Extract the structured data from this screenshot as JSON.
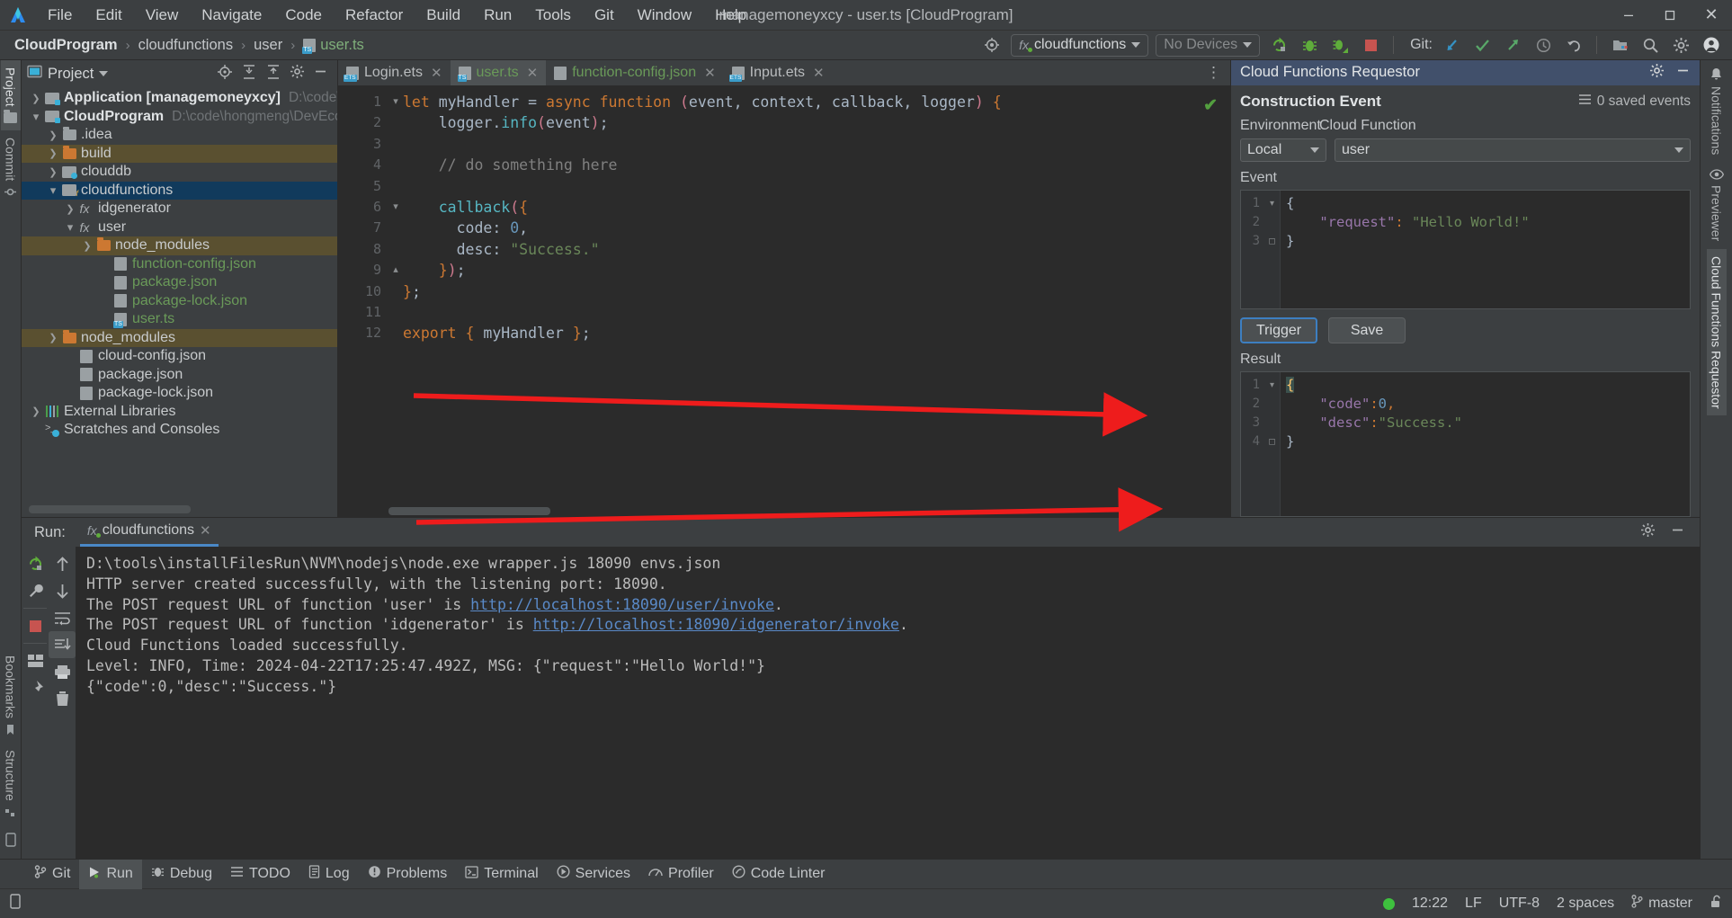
{
  "window": {
    "title": "managemoneyxcy - user.ts [CloudProgram]",
    "minimize": "–",
    "maximize": "❐",
    "close": "✕"
  },
  "menu": {
    "items": [
      "File",
      "Edit",
      "View",
      "Navigate",
      "Code",
      "Refactor",
      "Build",
      "Run",
      "Tools",
      "Git",
      "Window",
      "Help"
    ]
  },
  "breadcrumb": {
    "project": "CloudProgram",
    "folder": "cloudfunctions",
    "module": "user",
    "file": "user.ts",
    "separator": "›"
  },
  "toolbar": {
    "run_config": "cloudfunctions",
    "run_config_prefix": "fx",
    "device": "No Devices",
    "git_label": "Git:",
    "icons": [
      "target-icon",
      "run-icon",
      "debug-icon",
      "profile-debug-icon",
      "stop-icon",
      "git-update-icon",
      "git-commit-icon",
      "git-push-icon",
      "git-history-icon",
      "git-rollback-icon",
      "project-structure-icon",
      "search-icon",
      "settings-icon",
      "account-icon"
    ]
  },
  "left_rail": {
    "items": [
      {
        "label": "Project",
        "icon": "folder-icon",
        "active": true
      },
      {
        "label": "Commit",
        "icon": "commit-icon",
        "active": false
      }
    ],
    "bottom_items": [
      {
        "label": "Bookmarks",
        "icon": "bookmark-icon"
      },
      {
        "label": "Structure",
        "icon": "structure-icon"
      }
    ]
  },
  "right_rail": {
    "items": [
      {
        "label": "Notifications",
        "icon": "bell-icon",
        "active": false
      },
      {
        "label": "Previewer",
        "icon": "eye-icon",
        "active": false
      },
      {
        "label": "Cloud Functions Requestor",
        "icon": "",
        "active": true
      }
    ]
  },
  "project_panel": {
    "title": "Project",
    "header_icons": [
      "locate-icon",
      "expand-all-icon",
      "collapse-all-icon",
      "settings-icon",
      "hide-icon"
    ],
    "tree": [
      {
        "indent": 0,
        "arrow": "›",
        "icon": "module-icon",
        "label": "Application [managemoneyxcy]",
        "bold": true,
        "path": "D:\\code\\hongmen",
        "sel": ""
      },
      {
        "indent": 0,
        "arrow": "⌄",
        "icon": "module-icon",
        "label": "CloudProgram",
        "bold": true,
        "path": "D:\\code\\hongmeng\\DevEcoStudioP",
        "sel": ""
      },
      {
        "indent": 1,
        "arrow": "›",
        "icon": "folder-icon",
        "label": ".idea",
        "bold": false,
        "path": "",
        "sel": ""
      },
      {
        "indent": 1,
        "arrow": "›",
        "icon": "folder-orange-icon",
        "label": "build",
        "bold": false,
        "path": "",
        "sel": "sel-olive"
      },
      {
        "indent": 1,
        "arrow": "›",
        "icon": "db-folder-icon",
        "label": "clouddb",
        "bold": false,
        "path": "",
        "sel": ""
      },
      {
        "indent": 1,
        "arrow": "⌄",
        "icon": "fx-folder-icon",
        "label": "cloudfunctions",
        "bold": false,
        "path": "",
        "sel": "sel-blue"
      },
      {
        "indent": 2,
        "arrow": "›",
        "icon": "fx-icon",
        "label": "idgenerator",
        "bold": false,
        "path": "",
        "sel": ""
      },
      {
        "indent": 2,
        "arrow": "⌄",
        "icon": "fx-icon",
        "label": "user",
        "bold": false,
        "path": "",
        "sel": ""
      },
      {
        "indent": 3,
        "arrow": "›",
        "icon": "folder-orange-icon",
        "label": "node_modules",
        "bold": false,
        "path": "",
        "sel": "sel-olive"
      },
      {
        "indent": 4,
        "arrow": "",
        "icon": "json-icon",
        "label": "function-config.json",
        "bold": false,
        "path": "",
        "sel": "",
        "green": true
      },
      {
        "indent": 4,
        "arrow": "",
        "icon": "json-icon",
        "label": "package.json",
        "bold": false,
        "path": "",
        "sel": "",
        "green": true
      },
      {
        "indent": 4,
        "arrow": "",
        "icon": "json-icon",
        "label": "package-lock.json",
        "bold": false,
        "path": "",
        "sel": "",
        "green": true
      },
      {
        "indent": 4,
        "arrow": "",
        "icon": "ts-icon",
        "label": "user.ts",
        "bold": false,
        "path": "",
        "sel": "",
        "green": true
      },
      {
        "indent": 1,
        "arrow": "›",
        "icon": "folder-orange-icon",
        "label": "node_modules",
        "bold": false,
        "path": "",
        "sel": "sel-olive"
      },
      {
        "indent": 2,
        "arrow": "",
        "icon": "json-icon",
        "label": "cloud-config.json",
        "bold": false,
        "path": "",
        "sel": ""
      },
      {
        "indent": 2,
        "arrow": "",
        "icon": "json-icon",
        "label": "package.json",
        "bold": false,
        "path": "",
        "sel": ""
      },
      {
        "indent": 2,
        "arrow": "",
        "icon": "json-icon",
        "label": "package-lock.json",
        "bold": false,
        "path": "",
        "sel": ""
      },
      {
        "indent": 0,
        "arrow": "›",
        "icon": "library-icon",
        "label": "External Libraries",
        "bold": false,
        "path": "",
        "sel": ""
      },
      {
        "indent": 0,
        "arrow": "",
        "icon": "scratch-icon",
        "label": "Scratches and Consoles",
        "bold": false,
        "path": "",
        "sel": ""
      }
    ]
  },
  "editor": {
    "tabs": [
      {
        "label": "Login.ets",
        "icon": "ets-icon",
        "active": false,
        "green": false
      },
      {
        "label": "user.ts",
        "icon": "ts-icon",
        "active": true,
        "green": true
      },
      {
        "label": "function-config.json",
        "icon": "json-icon",
        "active": false,
        "green": true
      },
      {
        "label": "Input.ets",
        "icon": "ets-icon",
        "active": false,
        "green": false
      }
    ],
    "close_glyph": "✕",
    "more_glyph": "⋮",
    "line_numbers": [
      "1",
      "2",
      "3",
      "4",
      "5",
      "6",
      "7",
      "8",
      "9",
      "10",
      "11",
      "12"
    ],
    "inspection_status": "✔",
    "code_lines": [
      "let myHandler = async function (event, context, callback, logger) {",
      "    logger.info(event);",
      "",
      "    // do something here",
      "",
      "    callback({",
      "      code: 0,",
      "      desc: \"Success.\"",
      "    });",
      "};",
      "",
      "export { myHandler };"
    ]
  },
  "cfr": {
    "title": "Cloud Functions Requestor",
    "settings_icon": "gear-icon",
    "hide_icon": "minimize-icon",
    "section_title": "Construction Event",
    "saved_events": "0 saved events",
    "label_environment": "Environment",
    "label_cloud_function": "Cloud Function",
    "environment_value": "Local",
    "cloud_function_value": "user",
    "label_event": "Event",
    "event_line_numbers": [
      "1",
      "2",
      "3"
    ],
    "event_json": {
      "line1": "{",
      "key": "\"request\"",
      "colon": ": ",
      "value": "\"Hello World!\"",
      "line3": "}"
    },
    "trigger_label": "Trigger",
    "save_label": "Save",
    "label_result": "Result",
    "result_line_numbers": [
      "1",
      "2",
      "3",
      "4"
    ],
    "result_json": {
      "line1": "{",
      "key_code": "\"code\"",
      "val_code": "0",
      "key_desc": "\"desc\"",
      "val_desc": "\"Success.\"",
      "line4": "}"
    }
  },
  "run_panel": {
    "label": "Run:",
    "tab_label": "cloudfunctions",
    "tab_prefix": "fx",
    "tab_close": "✕",
    "gutter_icons": [
      "rerun-icon",
      "wrench-icon",
      "stop-icon",
      "layout-icon",
      "pin-icon",
      "scroll-up-icon",
      "scroll-down-icon",
      "soft-wrap-icon",
      "scroll-to-end-icon",
      "print-icon",
      "clear-all-icon"
    ],
    "header_icons": [
      "settings-icon",
      "hide-icon"
    ],
    "console_lines": [
      {
        "text": "D:\\tools\\installFilesRun\\NVM\\nodejs\\node.exe wrapper.js 18090 envs.json",
        "link": ""
      },
      {
        "text": "HTTP server created successfully, with the listening port: 18090.",
        "link": ""
      },
      {
        "text": "The POST request URL of function 'user' is ",
        "link": "http://localhost:18090/user/invoke",
        "tail": "."
      },
      {
        "text": "The POST request URL of function 'idgenerator' is ",
        "link": "http://localhost:18090/idgenerator/invoke",
        "tail": "."
      },
      {
        "text": "Cloud Functions loaded successfully.",
        "link": ""
      },
      {
        "text": "Level: INFO, Time: 2024-04-22T17:25:47.492Z, MSG: {\"request\":\"Hello World!\"}",
        "link": ""
      },
      {
        "text": "{\"code\":0,\"desc\":\"Success.\"}",
        "link": ""
      }
    ]
  },
  "toolwindow_bar": {
    "items": [
      {
        "label": "Git",
        "icon": "git-icon",
        "active": false
      },
      {
        "label": "Run",
        "icon": "run-icon",
        "active": true
      },
      {
        "label": "Debug",
        "icon": "debug-icon",
        "active": false
      },
      {
        "label": "TODO",
        "icon": "todo-icon",
        "active": false
      },
      {
        "label": "Log",
        "icon": "log-icon",
        "active": false
      },
      {
        "label": "Problems",
        "icon": "problems-icon",
        "active": false
      },
      {
        "label": "Terminal",
        "icon": "terminal-icon",
        "active": false
      },
      {
        "label": "Services",
        "icon": "services-icon",
        "active": false
      },
      {
        "label": "Profiler",
        "icon": "profiler-icon",
        "active": false
      },
      {
        "label": "Code Linter",
        "icon": "code-linter-icon",
        "active": false
      }
    ]
  },
  "statusbar": {
    "left_icon": "device-icon",
    "time": "12:22",
    "line_separator": "LF",
    "encoding": "UTF-8",
    "indent": "2 spaces",
    "branch": "master",
    "lock_icon": "unlocked-icon"
  },
  "colors": {
    "accent_blue": "#3d7fc1",
    "panel_header_blue": "#41506b",
    "selection_blue": "#113a5c",
    "selection_olive": "#5a5030",
    "arrow_red": "#ee1c1c",
    "green_string": "#6a8759",
    "orange_keyword": "#cc7832"
  }
}
